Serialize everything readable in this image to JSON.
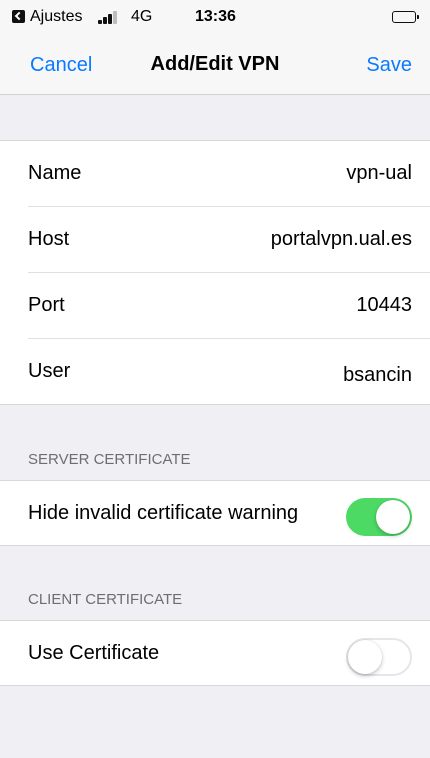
{
  "status_bar": {
    "back_app": "Ajustes",
    "network": "4G",
    "time": "13:36",
    "back_icon": "back-to-app-icon",
    "signal_icon": "cellular-signal-icon",
    "battery_icon": "battery-icon"
  },
  "nav": {
    "cancel_label": "Cancel",
    "title": "Add/Edit VPN",
    "save_label": "Save"
  },
  "general": {
    "rows": [
      {
        "label": "Name",
        "value": "vpn-ual"
      },
      {
        "label": "Host",
        "value": "portalvpn.ual.es"
      },
      {
        "label": "Port",
        "value": "10443"
      },
      {
        "label": "User",
        "value": "bsancin"
      }
    ]
  },
  "server_certificate": {
    "header": "SERVER CERTIFICATE",
    "hide_invalid": {
      "label": "Hide invalid certificate warning",
      "enabled": true
    }
  },
  "client_certificate": {
    "header": "CLIENT CERTIFICATE",
    "use_certificate": {
      "label": "Use Certificate",
      "enabled": false
    }
  },
  "colors": {
    "accent": "#0a7aff",
    "toggle_on": "#4cd964",
    "background": "#efeff4"
  }
}
